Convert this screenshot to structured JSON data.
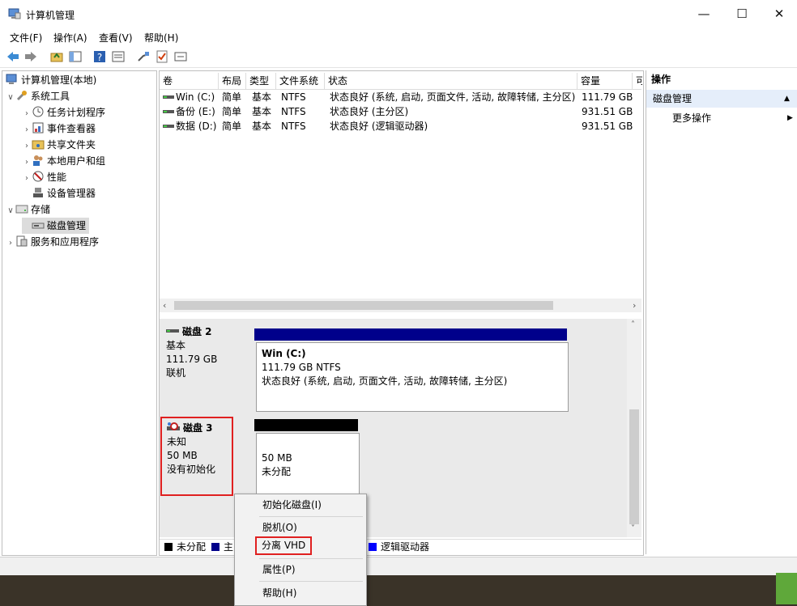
{
  "window": {
    "title": "计算机管理"
  },
  "menu": [
    "文件(F)",
    "操作(A)",
    "查看(V)",
    "帮助(H)"
  ],
  "tree": {
    "root": "计算机管理(本地)",
    "system_tools": "系统工具",
    "task_scheduler": "任务计划程序",
    "event_viewer": "事件查看器",
    "shared_folders": "共享文件夹",
    "local_users": "本地用户和组",
    "performance": "性能",
    "device_manager": "设备管理器",
    "storage": "存储",
    "disk_management": "磁盘管理",
    "services": "服务和应用程序"
  },
  "volume_table": {
    "headers": [
      "卷",
      "布局",
      "类型",
      "文件系统",
      "状态",
      "容量",
      "可"
    ],
    "rows": [
      {
        "volume": "Win (C:)",
        "layout": "简单",
        "type": "基本",
        "fs": "NTFS",
        "status": "状态良好 (系统, 启动, 页面文件, 活动, 故障转储, 主分区)",
        "capacity": "111.79 GB"
      },
      {
        "volume": "备份 (E:)",
        "layout": "简单",
        "type": "基本",
        "fs": "NTFS",
        "status": "状态良好 (主分区)",
        "capacity": "931.51 GB"
      },
      {
        "volume": "数据 (D:)",
        "layout": "简单",
        "type": "基本",
        "fs": "NTFS",
        "status": "状态良好 (逻辑驱动器)",
        "capacity": "931.51 GB"
      }
    ]
  },
  "disks": [
    {
      "name": "磁盘 2",
      "type": "基本",
      "size": "111.79 GB",
      "state": "联机",
      "partition": {
        "name": "Win  (C:)",
        "size": "111.79 GB NTFS",
        "status": "状态良好 (系统, 启动, 页面文件, 活动, 故障转储, 主分区)"
      }
    },
    {
      "name": "磁盘 3",
      "type": "未知",
      "size": "50 MB",
      "state": "没有初始化",
      "partition": {
        "size": "50 MB",
        "status": "未分配"
      }
    }
  ],
  "legend": {
    "unallocated": "未分配",
    "primary": "主",
    "logical": "逻辑驱动器"
  },
  "actions": {
    "header": "操作",
    "section": "磁盘管理",
    "more": "更多操作"
  },
  "context_menu": {
    "initialize": "初始化磁盘(I)",
    "offline": "脱机(O)",
    "detach": "分离 VHD",
    "properties": "属性(P)",
    "help": "帮助(H)"
  },
  "colors": {
    "primary_bar": "#00008b",
    "unallocated_bar": "#000000",
    "logical_legend": "#0000ff",
    "highlight": "#e02020",
    "selection": "#dcdcdc"
  }
}
